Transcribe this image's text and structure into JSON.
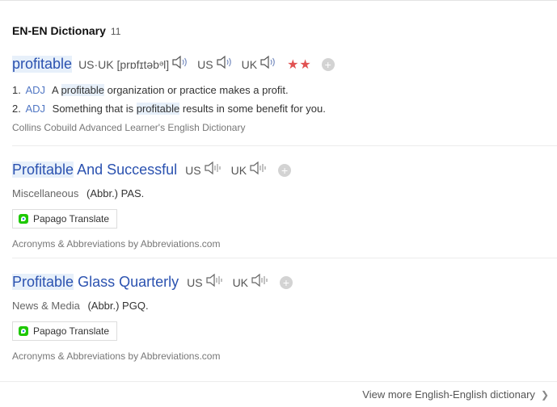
{
  "header": {
    "title": "EN-EN Dictionary",
    "count": "11"
  },
  "entries": [
    {
      "headword": "profitable",
      "pronunciation": "US·UK [prɒfɪtəbᵊl]",
      "us_label": "US",
      "uk_label": "UK",
      "stars": "★★",
      "definitions": [
        {
          "num": "1.",
          "pos": "ADJ",
          "before": "A",
          "highlight": "profitable",
          "after": "organization or practice makes a profit."
        },
        {
          "num": "2.",
          "pos": "ADJ",
          "before": "Something that is",
          "highlight": "profitable",
          "after": "results in some benefit for you."
        }
      ],
      "source": "Collins Cobuild Advanced Learner's English Dictionary"
    },
    {
      "headword_highlight": "Profitable",
      "headword_rest": "And Successful",
      "us_label": "US",
      "uk_label": "UK",
      "category": "Miscellaneous",
      "abbr": "(Abbr.) PAS.",
      "translate": "Papago Translate",
      "source": "Acronyms & Abbreviations by Abbreviations.com"
    },
    {
      "headword_highlight": "Profitable",
      "headword_rest": "Glass Quarterly",
      "us_label": "US",
      "uk_label": "UK",
      "category": "News & Media",
      "abbr": "(Abbr.) PGQ.",
      "translate": "Papago Translate",
      "source": "Acronyms & Abbreviations by Abbreviations.com"
    }
  ],
  "footer": {
    "more": "View more English-English dictionary"
  },
  "icons": {
    "speaker": "speaker-icon",
    "add": "plus-icon",
    "papago": "papago-icon",
    "chevron": "chevron-right-icon"
  },
  "colors": {
    "headword": "#2b52b0",
    "highlight": "#e7f0fa",
    "stars": "#e15252",
    "pos": "#5177c4"
  }
}
